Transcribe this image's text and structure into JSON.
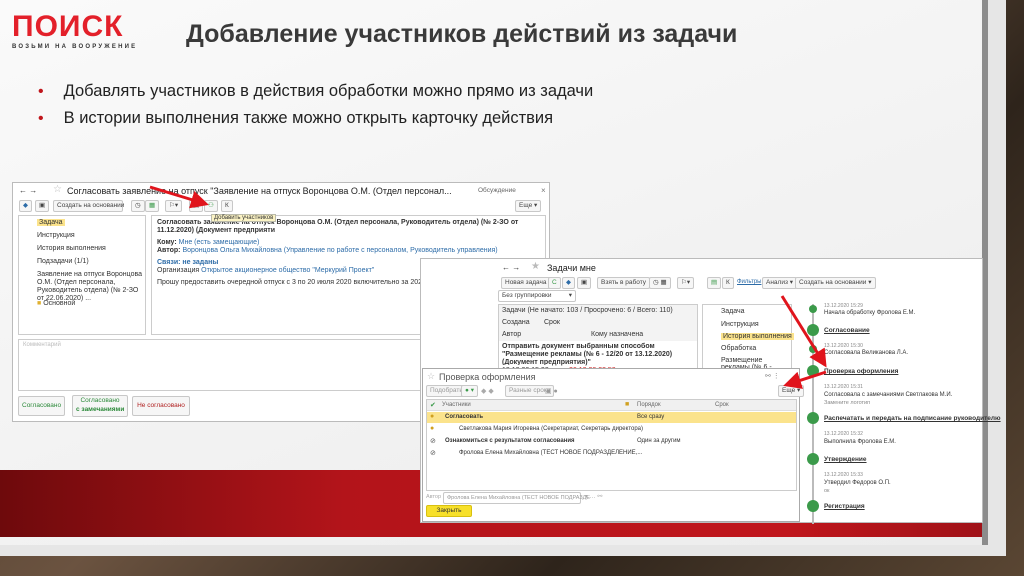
{
  "logo": {
    "word": "ПОИСК",
    "tagline": "ВОЗЬМИ НА ВООРУЖЕНИЕ"
  },
  "slide": {
    "title": "Добавление участников действий из задачи",
    "bullets": [
      "Добавлять участников в действия обработки можно прямо из задачи",
      "В истории выполнения также можно открыть карточку действия"
    ]
  },
  "task_window": {
    "title": "Согласовать заявление на отпуск \"Заявление на отпуск Воронцова О.М. (Отдел персонал...",
    "discussion": "Обсуждение",
    "create_based": "Создать на основании",
    "more": "Еще",
    "k": "К",
    "tooltip": "Добавить участников",
    "tree": [
      "Задача",
      "Инструкция",
      "История выполнения",
      "Подзадачи (1/1)",
      "Заявление на отпуск Воронцова О.М. (Отдел персонала, Руководитель отдела) (№ 2-ЗО от 22.06.2020) ...",
      "Основной"
    ],
    "content": {
      "heading": "Согласовать заявление на отпуск Воронцова О.М. (Отдел персонала, Руководитель отдела) (№ 2-ЗО от 11.12.2020) (Документ предприяти",
      "to_label": "Кому:",
      "to_value": "Мне (есть замещающие)",
      "author_label": "Автор:",
      "author_value": "Воронцова Ольга Михайловна (Управление по работе с персоналом, Руководитель управления)",
      "links": "Связи: не заданы",
      "org_label": "Организация",
      "org_value": "Открытое акционерное общество \"Меркурий Проект\"",
      "body": "Прошу предоставить очередной отпуск с 3 по 20 июля 2020 включительно за 2020 год согласно граф"
    },
    "comment_placeholder": "Комментарий",
    "buttons": {
      "approved": "Согласовано",
      "approved_remarks_1": "Согласовано",
      "approved_remarks_2": "с замечаниями",
      "rejected": "Не согласовано"
    }
  },
  "tasks_window": {
    "title": "Задачи мне",
    "new_task": "Новая задача",
    "take": "Взять в работу",
    "k": "К",
    "filters": "Фильтры",
    "analysis": "Анализ",
    "create_based": "Создать на основании",
    "grouping": "Без группировки",
    "summary": "Задачи (Не начато: 103 / Просрочено: 6 / Всего: 110)",
    "columns": [
      "Создана",
      "Срок",
      "Автор",
      "Кому назначена"
    ],
    "row": {
      "text": "Отправить документ выбранным способом \"Размещение рекламы (№ 6 - 12/20 от 13.12.2020) (Документ предприятия)\"",
      "created": "13.12.20 15:33",
      "due": "26.12.20 23:59"
    },
    "tree": [
      "Задача",
      "Инструкция",
      "История выполнения",
      "Обработка",
      "Размещение рекламы (№ 6 - 12/20 от 13.12.2020)"
    ],
    "timeline": [
      {
        "date": "13.12.2020 15:29",
        "text": "Начала обработку Фролова Е.М."
      },
      {
        "head": "Согласование"
      },
      {
        "date": "13.12.2020 15:30",
        "text": "Согласовала Великанова Л.А."
      },
      {
        "head": "Проверка оформления"
      },
      {
        "date": "13.12.2020 15:31",
        "text": "Согласовала с замечаниями Светлакова М.И.",
        "note": "Замените логотип"
      },
      {
        "head": "Распечатать и передать на подписание руководителю"
      },
      {
        "date": "13.12.2020 15:32",
        "text": "Выполнила Фролова Е.М."
      },
      {
        "head": "Утверждение"
      },
      {
        "date": "13.12.2020 15:33",
        "text": "Утвердил Федоров О.П.",
        "note": "ок"
      },
      {
        "head": "Регистрация"
      }
    ]
  },
  "dialog": {
    "title": "Проверка оформления",
    "pick": "Подобрать",
    "diff_terms": "Разные сроки",
    "more": "Еще",
    "columns": [
      "Участники",
      "Порядок",
      "Срок"
    ],
    "rows": [
      {
        "name": "Согласовать",
        "order": "Все сразу",
        "group": true
      },
      {
        "name": "Светлакова Мария Игоревна (Секретариат, Секретарь директора)",
        "order": ""
      },
      {
        "name": "Ознакомиться с результатом согласования",
        "order": "Один за другим",
        "group": true
      },
      {
        "name": "Фролова Елена Михайловна (ТЕСТ НОВОЕ ПОДРАЗДЕЛЕНИЕ,...",
        "order": ""
      }
    ],
    "author_label": "Автор",
    "author_value": "Фролова Елена Михайловна (ТЕСТ НОВОЕ ПОДРАЗДЕ",
    "close": "Закрыть"
  },
  "colors": {
    "accent": "#c0161c",
    "highlight": "#fbe38c",
    "green": "#3b9a4a"
  }
}
